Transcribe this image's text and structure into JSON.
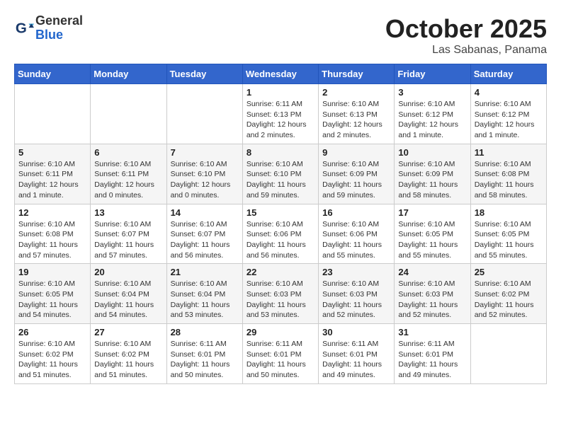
{
  "header": {
    "logo_general": "General",
    "logo_blue": "Blue",
    "month_title": "October 2025",
    "location": "Las Sabanas, Panama"
  },
  "weekdays": [
    "Sunday",
    "Monday",
    "Tuesday",
    "Wednesday",
    "Thursday",
    "Friday",
    "Saturday"
  ],
  "weeks": [
    [
      {
        "day": "",
        "info": ""
      },
      {
        "day": "",
        "info": ""
      },
      {
        "day": "",
        "info": ""
      },
      {
        "day": "1",
        "info": "Sunrise: 6:11 AM\nSunset: 6:13 PM\nDaylight: 12 hours and 2 minutes."
      },
      {
        "day": "2",
        "info": "Sunrise: 6:10 AM\nSunset: 6:13 PM\nDaylight: 12 hours and 2 minutes."
      },
      {
        "day": "3",
        "info": "Sunrise: 6:10 AM\nSunset: 6:12 PM\nDaylight: 12 hours and 1 minute."
      },
      {
        "day": "4",
        "info": "Sunrise: 6:10 AM\nSunset: 6:12 PM\nDaylight: 12 hours and 1 minute."
      }
    ],
    [
      {
        "day": "5",
        "info": "Sunrise: 6:10 AM\nSunset: 6:11 PM\nDaylight: 12 hours and 1 minute."
      },
      {
        "day": "6",
        "info": "Sunrise: 6:10 AM\nSunset: 6:11 PM\nDaylight: 12 hours and 0 minutes."
      },
      {
        "day": "7",
        "info": "Sunrise: 6:10 AM\nSunset: 6:10 PM\nDaylight: 12 hours and 0 minutes."
      },
      {
        "day": "8",
        "info": "Sunrise: 6:10 AM\nSunset: 6:10 PM\nDaylight: 11 hours and 59 minutes."
      },
      {
        "day": "9",
        "info": "Sunrise: 6:10 AM\nSunset: 6:09 PM\nDaylight: 11 hours and 59 minutes."
      },
      {
        "day": "10",
        "info": "Sunrise: 6:10 AM\nSunset: 6:09 PM\nDaylight: 11 hours and 58 minutes."
      },
      {
        "day": "11",
        "info": "Sunrise: 6:10 AM\nSunset: 6:08 PM\nDaylight: 11 hours and 58 minutes."
      }
    ],
    [
      {
        "day": "12",
        "info": "Sunrise: 6:10 AM\nSunset: 6:08 PM\nDaylight: 11 hours and 57 minutes."
      },
      {
        "day": "13",
        "info": "Sunrise: 6:10 AM\nSunset: 6:07 PM\nDaylight: 11 hours and 57 minutes."
      },
      {
        "day": "14",
        "info": "Sunrise: 6:10 AM\nSunset: 6:07 PM\nDaylight: 11 hours and 56 minutes."
      },
      {
        "day": "15",
        "info": "Sunrise: 6:10 AM\nSunset: 6:06 PM\nDaylight: 11 hours and 56 minutes."
      },
      {
        "day": "16",
        "info": "Sunrise: 6:10 AM\nSunset: 6:06 PM\nDaylight: 11 hours and 55 minutes."
      },
      {
        "day": "17",
        "info": "Sunrise: 6:10 AM\nSunset: 6:05 PM\nDaylight: 11 hours and 55 minutes."
      },
      {
        "day": "18",
        "info": "Sunrise: 6:10 AM\nSunset: 6:05 PM\nDaylight: 11 hours and 55 minutes."
      }
    ],
    [
      {
        "day": "19",
        "info": "Sunrise: 6:10 AM\nSunset: 6:05 PM\nDaylight: 11 hours and 54 minutes."
      },
      {
        "day": "20",
        "info": "Sunrise: 6:10 AM\nSunset: 6:04 PM\nDaylight: 11 hours and 54 minutes."
      },
      {
        "day": "21",
        "info": "Sunrise: 6:10 AM\nSunset: 6:04 PM\nDaylight: 11 hours and 53 minutes."
      },
      {
        "day": "22",
        "info": "Sunrise: 6:10 AM\nSunset: 6:03 PM\nDaylight: 11 hours and 53 minutes."
      },
      {
        "day": "23",
        "info": "Sunrise: 6:10 AM\nSunset: 6:03 PM\nDaylight: 11 hours and 52 minutes."
      },
      {
        "day": "24",
        "info": "Sunrise: 6:10 AM\nSunset: 6:03 PM\nDaylight: 11 hours and 52 minutes."
      },
      {
        "day": "25",
        "info": "Sunrise: 6:10 AM\nSunset: 6:02 PM\nDaylight: 11 hours and 52 minutes."
      }
    ],
    [
      {
        "day": "26",
        "info": "Sunrise: 6:10 AM\nSunset: 6:02 PM\nDaylight: 11 hours and 51 minutes."
      },
      {
        "day": "27",
        "info": "Sunrise: 6:10 AM\nSunset: 6:02 PM\nDaylight: 11 hours and 51 minutes."
      },
      {
        "day": "28",
        "info": "Sunrise: 6:11 AM\nSunset: 6:01 PM\nDaylight: 11 hours and 50 minutes."
      },
      {
        "day": "29",
        "info": "Sunrise: 6:11 AM\nSunset: 6:01 PM\nDaylight: 11 hours and 50 minutes."
      },
      {
        "day": "30",
        "info": "Sunrise: 6:11 AM\nSunset: 6:01 PM\nDaylight: 11 hours and 49 minutes."
      },
      {
        "day": "31",
        "info": "Sunrise: 6:11 AM\nSunset: 6:01 PM\nDaylight: 11 hours and 49 minutes."
      },
      {
        "day": "",
        "info": ""
      }
    ]
  ]
}
